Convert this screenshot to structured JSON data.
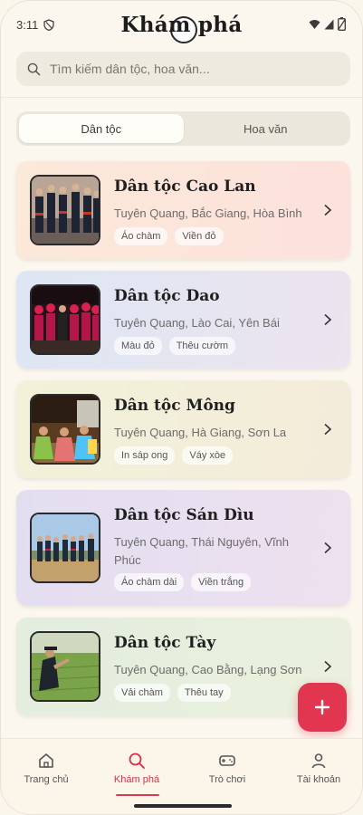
{
  "status_bar": {
    "time": "3:11"
  },
  "header": {
    "title": "Khám phá"
  },
  "search": {
    "placeholder": "Tìm kiếm dân tộc, hoa văn..."
  },
  "tabs": [
    {
      "label": "Dân tộc",
      "active": true
    },
    {
      "label": "Hoa văn",
      "active": false
    }
  ],
  "ethnic_groups": [
    {
      "name": "Dân tộc Cao Lan",
      "regions": "Tuyên Quang, Bắc Giang, Hòa Bình",
      "tags": [
        "Áo chàm",
        "Viền đỏ"
      ],
      "color": "#fde4dc"
    },
    {
      "name": "Dân tộc Dao",
      "regions": "Tuyên Quang, Lào Cai, Yên Bái",
      "tags": [
        "Màu đỏ",
        "Thêu cườm"
      ],
      "color": "#e2e6f3"
    },
    {
      "name": "Dân tộc Mông",
      "regions": "Tuyên Quang, Hà Giang, Sơn La",
      "tags": [
        "In sáp ong",
        "Váy xòe"
      ],
      "color": "#f3f0d8"
    },
    {
      "name": "Dân tộc Sán Dìu",
      "regions": "Tuyên Quang, Thái Nguyên, Vĩnh Phúc",
      "tags": [
        "Áo chàm dài",
        "Viền trắng"
      ],
      "color": "#ebe1f0"
    },
    {
      "name": "Dân tộc Tày",
      "regions": "Tuyên Quang, Cao Bằng, Lạng Sơn",
      "tags": [
        "Vải chàm",
        "Thêu tay"
      ],
      "color": "#e4efde"
    }
  ],
  "fab": {
    "icon": "plus-icon",
    "symbol": "+"
  },
  "bottom_nav": [
    {
      "label": "Trang chủ",
      "icon": "home-icon",
      "active": false
    },
    {
      "label": "Khám phá",
      "icon": "search-icon",
      "active": true
    },
    {
      "label": "Trò chơi",
      "icon": "gamepad-icon",
      "active": false
    },
    {
      "label": "Tài khoản",
      "icon": "user-icon",
      "active": false
    }
  ],
  "colors": {
    "accent": "#e23650",
    "background": "#fcf7ee"
  }
}
